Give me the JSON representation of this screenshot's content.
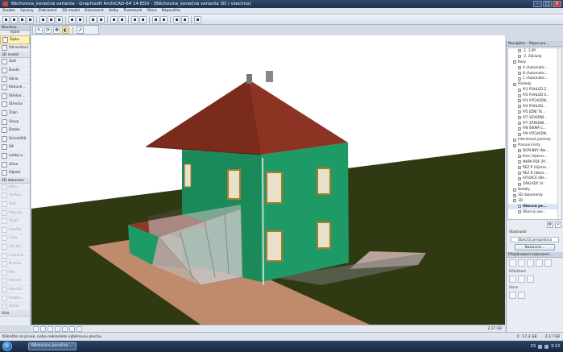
{
  "window": {
    "title": "Běchovice_konečná varianta - Graphisoft ArchiCAD-64 14 EDU - [Běchovice_konečná varianta 3D / všechno]"
  },
  "menu": [
    "Soubor",
    "Úpravy",
    "Zobrazení",
    "3D model",
    "Dokument",
    "Volby",
    "Teamwork",
    "Okno",
    "Nápověda"
  ],
  "toolbox": {
    "header": "Návrhov...",
    "select_label": "Výběr",
    "items_top": [
      {
        "label": "Šipka",
        "icon": "arrow-icon",
        "sel": true
      },
      {
        "label": "Ohraničení",
        "icon": "marquee-icon"
      }
    ],
    "group3d": "3D model",
    "items_3d": [
      {
        "label": "Zeď",
        "icon": "wall-icon"
      },
      {
        "label": "Dveře",
        "icon": "door-icon"
      },
      {
        "label": "Okno",
        "icon": "window-icon"
      },
      {
        "label": "Rohové...",
        "icon": "corner-window-icon"
      },
      {
        "label": "Střešní ...",
        "icon": "skylight-icon"
      },
      {
        "label": "Střecha",
        "icon": "roof-icon"
      },
      {
        "label": "Trám",
        "icon": "beam-icon"
      },
      {
        "label": "Sloup",
        "icon": "column-icon"
      },
      {
        "label": "Deska",
        "icon": "slab-icon"
      },
      {
        "label": "Schodiště",
        "icon": "stair-icon"
      },
      {
        "label": "Síť",
        "icon": "mesh-icon"
      },
      {
        "label": "Lehký o...",
        "icon": "curtain-wall-icon"
      },
      {
        "label": "Zóna",
        "icon": "zone-icon"
      },
      {
        "label": "Objekt",
        "icon": "object-icon"
      }
    ],
    "group2d": "2D dokumen",
    "items_2d": [
      {
        "label": "Kóta",
        "icon": "dimension-icon"
      },
      {
        "label": "Výškov...",
        "icon": "level-icon"
      },
      {
        "label": "Text",
        "icon": "text-icon"
      },
      {
        "label": "Popisky",
        "icon": "label-icon"
      },
      {
        "label": "Vyplň",
        "icon": "fill-icon"
      },
      {
        "label": "Úsečka",
        "icon": "line-icon"
      },
      {
        "label": "Čára",
        "icon": "arc-icon"
      },
      {
        "label": "Obl./Kr...",
        "icon": "circle-icon"
      },
      {
        "label": "Lomená...",
        "icon": "polyline-icon"
      },
      {
        "label": "Kresba",
        "icon": "drawing-icon"
      },
      {
        "label": "Řez",
        "icon": "section-icon"
      },
      {
        "label": "Pohled",
        "icon": "elevation-icon"
      },
      {
        "label": "Interiér...",
        "icon": "interior-icon"
      },
      {
        "label": "Prezen...",
        "icon": "worksheet-icon"
      },
      {
        "label": "Detail",
        "icon": "detail-icon"
      }
    ],
    "more": "Více"
  },
  "viewport": {
    "sky": "#ffffff",
    "grass": "#2f3a12",
    "wall": "#1e9a66",
    "roof": "#8c3424"
  },
  "view_status": {
    "zoom": "2,17 GB",
    "disk": "C: 17,3 GB"
  },
  "navigator": {
    "header": "Navigátor - Mapa pro...",
    "rows": [
      {
        "t": "-1. 1.PP",
        "indent": 2
      },
      {
        "t": "-2. Základy",
        "indent": 2
      },
      {
        "t": "Řezy",
        "indent": 1
      },
      {
        "t": "A (Automatic...",
        "indent": 2
      },
      {
        "t": "B (Automatic...",
        "indent": 2
      },
      {
        "t": "C (Automatic...",
        "indent": 2
      },
      {
        "t": "Pohledy",
        "indent": 1
      },
      {
        "t": "P/1 POHLED Z...",
        "indent": 2
      },
      {
        "t": "P/2 POHLED S...",
        "indent": 2
      },
      {
        "t": "P/3 VÝCHODN...",
        "indent": 2
      },
      {
        "t": "P/4 POHLED...",
        "indent": 2
      },
      {
        "t": "P/5 JIŽNÍ TE...",
        "indent": 2
      },
      {
        "t": "P/7 SEVERNÍ...",
        "indent": 2
      },
      {
        "t": "P/7 ZÁPADNÍ...",
        "indent": 2
      },
      {
        "t": "P/8 ŠIKMÁ C...",
        "indent": 2
      },
      {
        "t": "P/9 VÝCHODN...",
        "indent": 2
      },
      {
        "t": "Interiérové pohledy",
        "indent": 1
      },
      {
        "t": "Pracovní listy",
        "indent": 1
      },
      {
        "t": "DOPLŇKY (Ne...",
        "indent": 2
      },
      {
        "t": "Krov (Výkres...",
        "indent": 2
      },
      {
        "t": "MAPA PDF (Př...",
        "indent": 2
      },
      {
        "t": "ŘEZ P (Výkres...",
        "indent": 2
      },
      {
        "t": "ŘEZ B (Nezá...",
        "indent": 2
      },
      {
        "t": "SITUACE (Ne...",
        "indent": 2
      },
      {
        "t": "ZÁKLADY (V...",
        "indent": 2
      },
      {
        "t": "Detaily",
        "indent": 1
      },
      {
        "t": "3D dokumenty",
        "indent": 1
      },
      {
        "t": "3D",
        "indent": 1
      },
      {
        "t": "Obecná pe...",
        "indent": 2,
        "sel": true
      },
      {
        "t": "Obecný axo...",
        "indent": 2
      }
    ],
    "section": "Vlastnosti",
    "field": "Obecná perspektiva",
    "button": "Nastavení...",
    "quick_header": "Přizpůsobení zobrazení...",
    "lab1": "Důležitost",
    "lab2": "Sklon"
  },
  "statusbar": {
    "text": "Klikněte na prvek, nebo nakreslete výběrovou plochu.",
    "left_free": "C: 17,3 GB",
    "mem": "2,17 GB"
  },
  "taskbar": {
    "task": "Běchovice_konečná...",
    "time": "9:13",
    "lang": "CS"
  }
}
